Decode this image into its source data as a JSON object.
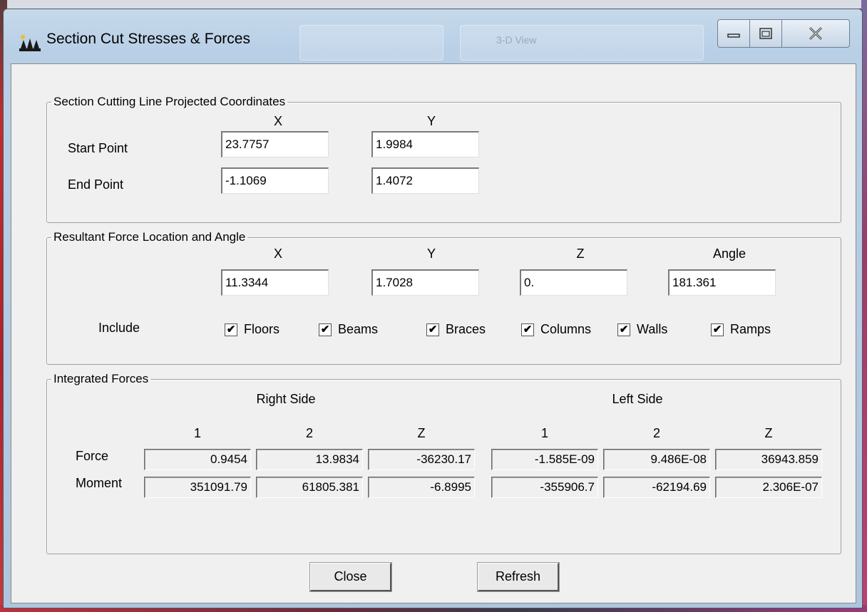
{
  "window": {
    "title": "Section Cut Stresses & Forces",
    "bg_tab_label": "3-D View"
  },
  "coords": {
    "legend": "Section Cutting Line Projected Coordinates",
    "col_x": "X",
    "col_y": "Y",
    "start_label": "Start Point",
    "start_x": "23.7757",
    "start_y": "1.9984",
    "end_label": "End Point",
    "end_x": "-1.1069",
    "end_y": "1.4072"
  },
  "resultant": {
    "legend": "Resultant Force Location and Angle",
    "col_x": "X",
    "col_y": "Y",
    "col_z": "Z",
    "col_angle": "Angle",
    "x": "11.3344",
    "y": "1.7028",
    "z": "0.",
    "angle": "181.361",
    "include_label": "Include",
    "include": [
      {
        "label": "Floors",
        "checked": true
      },
      {
        "label": "Beams",
        "checked": true
      },
      {
        "label": "Braces",
        "checked": true
      },
      {
        "label": "Columns",
        "checked": true
      },
      {
        "label": "Walls",
        "checked": true
      },
      {
        "label": "Ramps",
        "checked": true
      }
    ]
  },
  "forces": {
    "legend": "Integrated Forces",
    "right_side": "Right Side",
    "left_side": "Left Side",
    "cols": [
      "1",
      "2",
      "Z",
      "1",
      "2",
      "Z"
    ],
    "force_label": "Force",
    "moment_label": "Moment",
    "force": [
      "0.9454",
      "13.9834",
      "-36230.17",
      "-1.585E-09",
      "9.486E-08",
      "36943.859"
    ],
    "moment": [
      "351091.79",
      "61805.381",
      "-6.8995",
      "-355906.7",
      "-62194.69",
      "2.306E-07"
    ]
  },
  "buttons": {
    "close": "Close",
    "refresh": "Refresh"
  },
  "colors": {
    "title_bar": "#b8cfe6",
    "dialog_bg": "#f0f0f0"
  }
}
